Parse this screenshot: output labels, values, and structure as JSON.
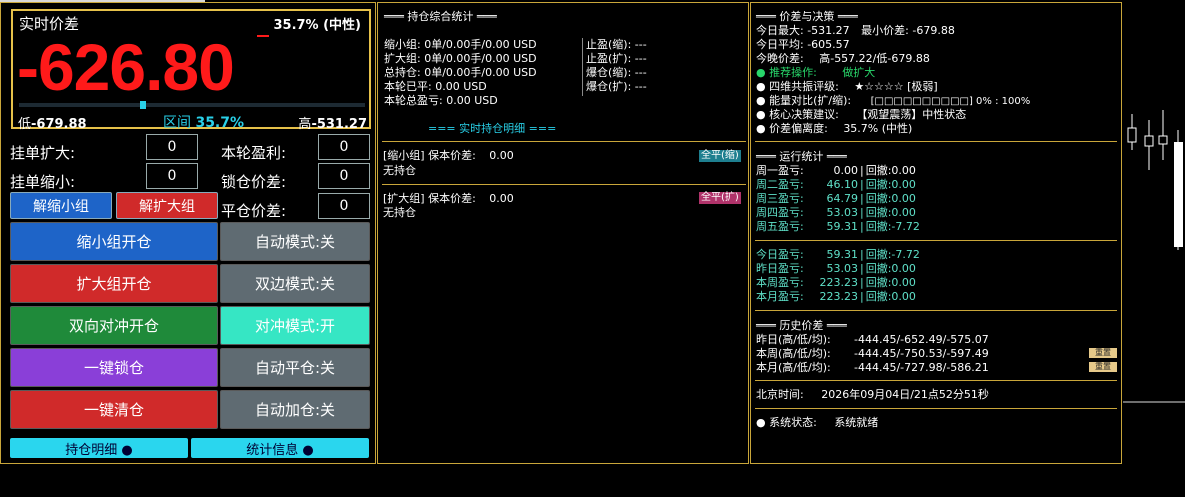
{
  "price_box": {
    "title": "实时价差",
    "pct": "35.7% (中性)",
    "value": "-626.80",
    "low_label": "低",
    "low_value": "-679.88",
    "range_label": "区间",
    "range_value": "35.7%",
    "high_label": "高",
    "high_value": "-531.27",
    "slider_level": 0.357
  },
  "left": {
    "rows": [
      {
        "label": "挂单扩大:",
        "value": "0"
      },
      {
        "label": "挂单缩小:",
        "value": "0"
      }
    ],
    "rrows": [
      {
        "label": "本轮盈利:",
        "value": "0"
      },
      {
        "label": "锁仓价差:",
        "value": "0"
      },
      {
        "label": "平仓价差:",
        "value": "0"
      }
    ],
    "unlock_small": "解缩小组",
    "unlock_big": "解扩大组",
    "buttons": [
      {
        "label": "缩小组开仓",
        "color": "#1e64c8"
      },
      {
        "label": "自动模式:关",
        "color": "#5f6b72"
      },
      {
        "label": "扩大组开仓",
        "color": "#d02a2a"
      },
      {
        "label": "双边模式:关",
        "color": "#5f6b72"
      },
      {
        "label": "双向对冲开仓",
        "color": "#1f8a3a"
      },
      {
        "label": "对冲模式:开",
        "color": "#36e6c4"
      },
      {
        "label": "一键锁仓",
        "color": "#8a3fd8"
      },
      {
        "label": "自动平仓:关",
        "color": "#5f6b72"
      },
      {
        "label": "一键清仓",
        "color": "#d02a2a"
      },
      {
        "label": "自动加仓:关",
        "color": "#5f6b72"
      }
    ],
    "tab_positions": "持仓明细 ●",
    "tab_stats": "统计信息 ●"
  },
  "mid": {
    "title": "═══ 持仓综合统计 ═══",
    "stats": [
      "缩小组: 0单/0.00手/0.00 USD",
      "扩大组: 0单/0.00手/0.00 USD",
      "总持仓: 0单/0.00手/0.00 USD",
      "本轮已平: 0.00 USD",
      "本轮总盈亏: 0.00 USD"
    ],
    "stats_r": [
      "止盈(缩): ---",
      "止盈(扩): ---",
      "爆仓(缩): ---",
      "爆仓(扩): ---"
    ],
    "detail_title": "=== 实时持仓明细 ===",
    "small_group": "[缩小组] 保本价差:",
    "small_value": "0.00",
    "small_empty": "无持仓",
    "small_btn": "全平(缩)",
    "big_group": "[扩大组] 保本价差:",
    "big_value": "0.00",
    "big_empty": "无持仓",
    "big_btn": "全平(扩)"
  },
  "right": {
    "title": "═══ 价差与决策 ═══",
    "today_max_lbl": "今日最大: -531.27",
    "today_min_lbl": "最小价差: -679.88",
    "today_avg": "今日平均: -605.57",
    "tonight": "今晚价差:",
    "tonight_val": "高-557.22/低-679.88",
    "recommend_lbl": "● 推荐操作:",
    "recommend_val": "做扩大",
    "resonance_lbl": "● 四维共振评级:",
    "resonance_val": "★☆☆☆☆ [极弱]",
    "energy_lbl": "● 能量对比(扩/缩):",
    "energy_val": "[□□□□□□□□□□] 0% : 100%",
    "core_lbl": "● 核心决策建议:",
    "core_val": "【观望震荡】中性状态",
    "dev_lbl": "● 价差偏离度:",
    "dev_val": "35.7% (中性)",
    "run_title": "═══ 运行统计 ═══",
    "weekdays": [
      {
        "day": "周一盈亏:",
        "val": "0.00",
        "dd": "回撤:0.00"
      },
      {
        "day": "周二盈亏:",
        "val": "46.10",
        "dd": "回撤:0.00"
      },
      {
        "day": "周三盈亏:",
        "val": "64.79",
        "dd": "回撤:0.00"
      },
      {
        "day": "周四盈亏:",
        "val": "53.03",
        "dd": "回撤:0.00"
      },
      {
        "day": "周五盈亏:",
        "val": "59.31",
        "dd": "回撤:-7.72"
      }
    ],
    "periods": [
      {
        "day": "今日盈亏:",
        "val": "59.31",
        "dd": "回撤:-7.72"
      },
      {
        "day": "昨日盈亏:",
        "val": "53.03",
        "dd": "回撤:0.00"
      },
      {
        "day": "本周盈亏:",
        "val": "223.23",
        "dd": "回撤:0.00"
      },
      {
        "day": "本月盈亏:",
        "val": "223.23",
        "dd": "回撤:0.00"
      }
    ],
    "hist_title": "═══ 历史价差 ═══",
    "hist": [
      {
        "lbl": "昨日(高/低/均):",
        "val": "-444.45/-652.49/-575.07"
      },
      {
        "lbl": "本周(高/低/均):",
        "val": "-444.45/-750.53/-597.49"
      },
      {
        "lbl": "本月(高/低/均):",
        "val": "-444.45/-727.98/-586.21"
      }
    ],
    "reset": "重置",
    "beijing_lbl": "北京时间:",
    "beijing_val": "2026年09月04日/21点52分51秒",
    "status_lbl": "● 系统状态:",
    "status_val": "系统就绪"
  }
}
